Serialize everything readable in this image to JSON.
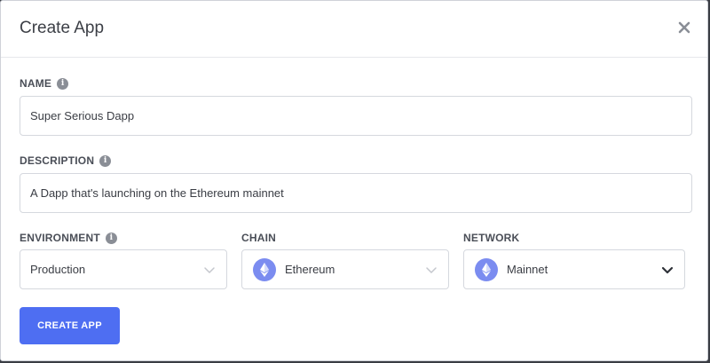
{
  "modal": {
    "title": "Create App",
    "close_icon": "close-icon"
  },
  "form": {
    "name": {
      "label": "NAME",
      "value": "Super Serious Dapp"
    },
    "description": {
      "label": "DESCRIPTION",
      "value": "A Dapp that's launching on the Ethereum mainnet"
    },
    "environment": {
      "label": "ENVIRONMENT",
      "value": "Production"
    },
    "chain": {
      "label": "CHAIN",
      "value": "Ethereum",
      "icon": "ethereum-icon"
    },
    "network": {
      "label": "NETWORK",
      "value": "Mainnet",
      "icon": "ethereum-icon"
    },
    "submit_label": "CREATE APP"
  },
  "colors": {
    "accent": "#4e6ef2",
    "eth_badge": "#7b8cf0"
  }
}
